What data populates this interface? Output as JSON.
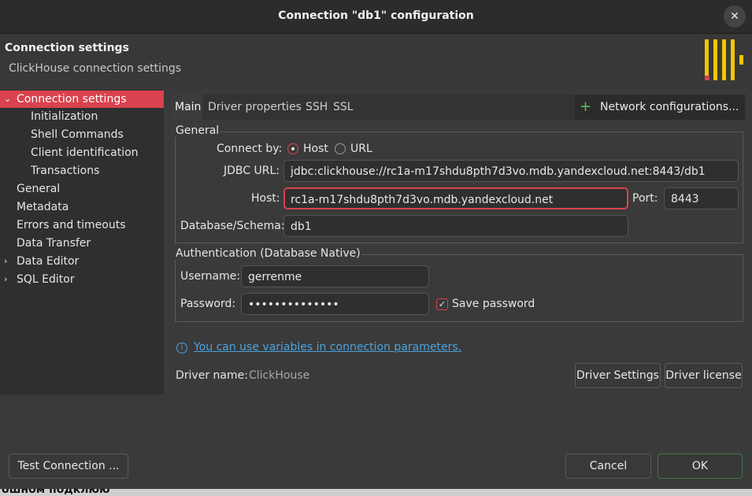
{
  "window": {
    "title": "Connection \"db1\" configuration",
    "close": "✕"
  },
  "header": {
    "title": "Connection settings",
    "subtitle": "ClickHouse connection settings"
  },
  "sidebar": {
    "items": [
      {
        "label": "Connection settings",
        "expanded": true,
        "active": true
      },
      {
        "label": "Initialization"
      },
      {
        "label": "Shell Commands"
      },
      {
        "label": "Client identification"
      },
      {
        "label": "Transactions"
      },
      {
        "label": "General"
      },
      {
        "label": "Metadata"
      },
      {
        "label": "Errors and timeouts"
      },
      {
        "label": "Data Transfer"
      },
      {
        "label": "Data Editor",
        "collapsed": true
      },
      {
        "label": "SQL Editor",
        "collapsed": true
      }
    ]
  },
  "tabs": [
    "Main",
    "Driver properties",
    "SSH",
    "SSL"
  ],
  "network": {
    "plus": "+",
    "label": "Network configurations..."
  },
  "general": {
    "legend": "General",
    "connect_by_label": "Connect by:",
    "host_option": "Host",
    "url_option": "URL",
    "jdbc_label": "JDBC URL:",
    "jdbc_value": "jdbc:clickhouse://rc1a-m17shdu8pth7d3vo.mdb.yandexcloud.net:8443/db1",
    "host_label": "Host:",
    "host_value": "rc1a-m17shdu8pth7d3vo.mdb.yandexcloud.net",
    "port_label": "Port:",
    "port_value": "8443",
    "db_label": "Database/Schema:",
    "db_value": "db1"
  },
  "auth": {
    "legend": "Authentication (Database Native)",
    "username_label": "Username:",
    "username_value": "gerrenme",
    "password_label": "Password:",
    "password_value": "••••••••••••••",
    "save_password": "Save password",
    "save_checked": "✓"
  },
  "info": {
    "icon": "i",
    "link": "You can use variables in connection parameters."
  },
  "driver": {
    "label": "Driver name:",
    "value": "ClickHouse",
    "settings_button": "Driver Settings",
    "license_button": "Driver license"
  },
  "footer": {
    "test_button": "Test Connection ...",
    "cancel_button": "Cancel",
    "ok_button": "OK"
  },
  "background_text": "ошном подклюю",
  "colors": {
    "accent": "#d9424e",
    "link": "#4aa3df",
    "logo": "#f2c500"
  }
}
